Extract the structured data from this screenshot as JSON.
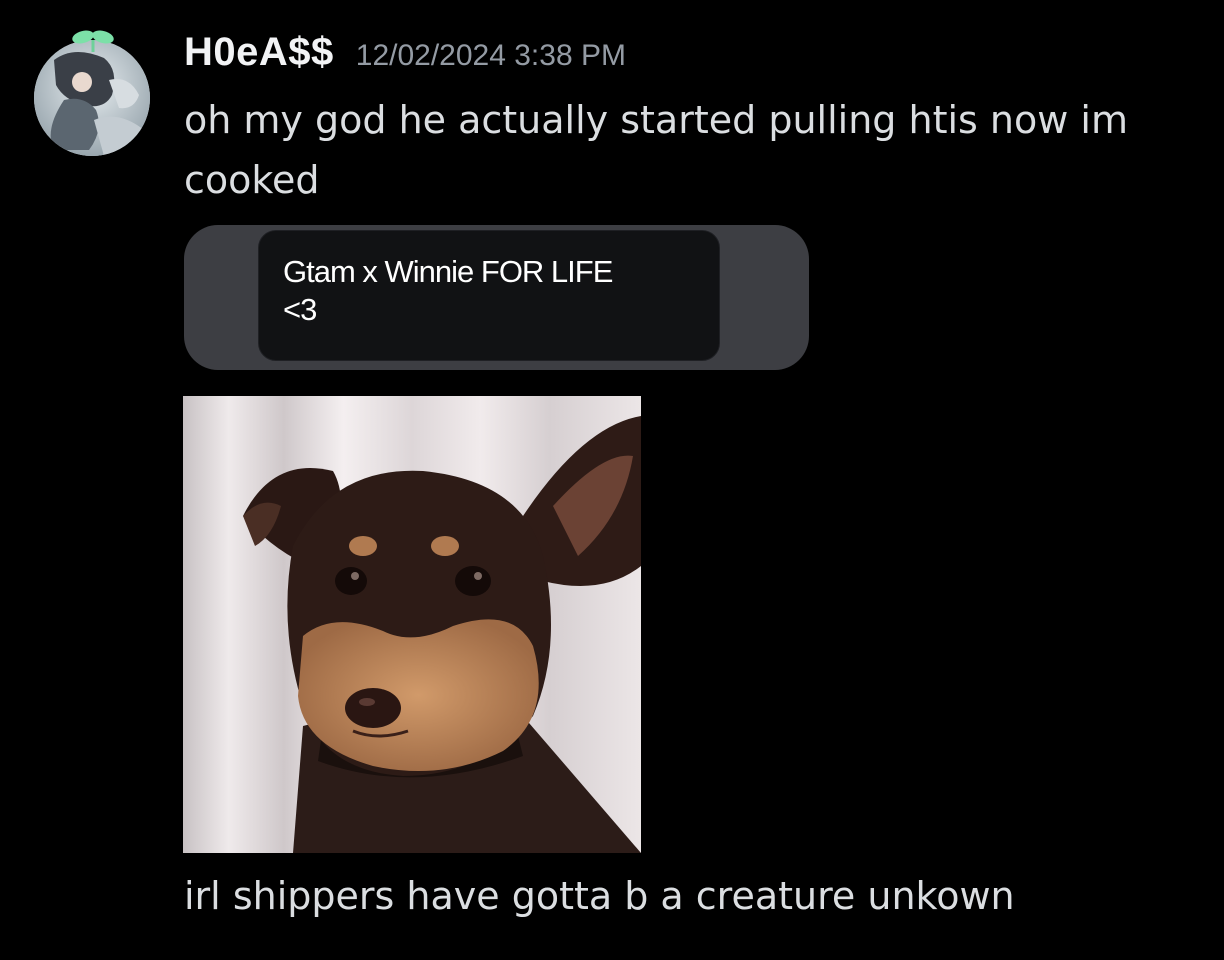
{
  "message": {
    "author": "H0eA$$",
    "timestamp": "12/02/2024 3:38 PM",
    "text_lines": [
      "oh my god he actually started pulling htis now im cooked",
      "irl shippers have gotta b a creature unkown"
    ],
    "quoted_card": {
      "line1": "Gtam x Winnie FOR LIFE",
      "line2": "<3"
    },
    "gif": {
      "subject": "dog-looking-sad"
    }
  },
  "colors": {
    "background": "#000000",
    "username": "#f2f3f5",
    "timestamp": "#949ba4",
    "body_text": "#dbdee1",
    "quote_outer": "#3d3e43",
    "quote_inner": "#111214"
  }
}
